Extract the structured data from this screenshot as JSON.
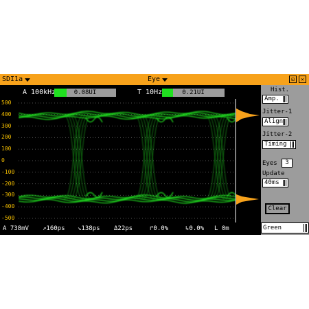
{
  "titlebar": {
    "source": "SDI1a",
    "mode": "Eye",
    "restore_glyph": "⊡",
    "close_glyph": "✕"
  },
  "jitter": {
    "a_label": "A 100kHz",
    "a_value": "0.08UI",
    "a_fill": 0.2,
    "t_label": "T 10Hz",
    "t_value": "0.21UI",
    "t_fill": 0.18
  },
  "axis": {
    "y_ticks": [
      "500",
      "400",
      "300",
      "200",
      "100",
      "0",
      "-100",
      "-200",
      "-300",
      "-400",
      "-500"
    ]
  },
  "readout": {
    "amplitude": "A 738mV",
    "rise": "↗160ps",
    "fall": "↘138ps",
    "delta": "Δ22ps",
    "overshoot_rise": "↱0.0%",
    "overshoot_fall": "↳0.0%",
    "length": "L 0m"
  },
  "panel": {
    "hist_label": "Hist.",
    "hist_value": "Amp.",
    "jitter1_label": "Jitter-1",
    "jitter1_value": "Align",
    "jitter2_label": "Jitter-2",
    "jitter2_value": "Timing",
    "eyes_label": "Eyes",
    "eyes_value": "3",
    "update_label": "Update",
    "update_value": "40ms",
    "clear_label": "Clear",
    "color_value": "Green"
  },
  "colors": {
    "accent": "#f7a21b",
    "trace": "#20e020",
    "panel": "#9c9c9c"
  }
}
